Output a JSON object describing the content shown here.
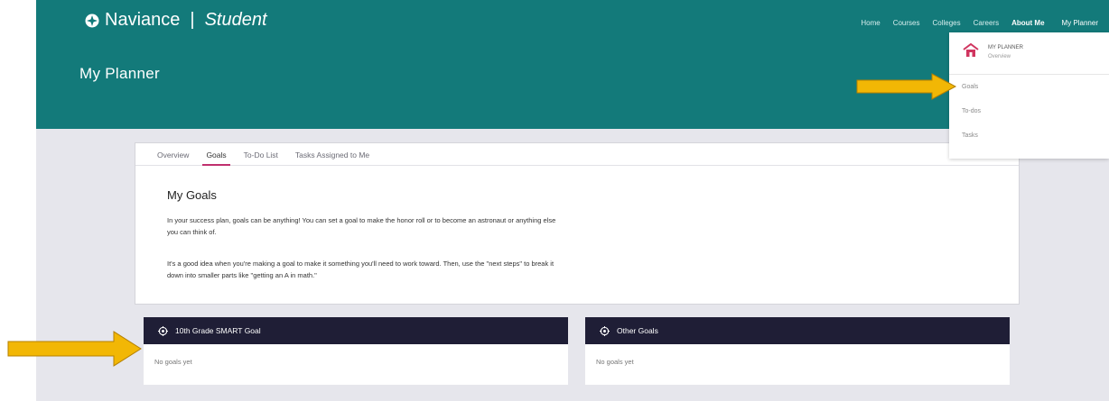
{
  "brand": {
    "name": "Naviance",
    "product": "Student",
    "separator": "|"
  },
  "nav": {
    "items": [
      "Home",
      "Courses",
      "Colleges",
      "Careers",
      "About Me"
    ],
    "active": "My Planner"
  },
  "page_title": "My Planner",
  "tabs": [
    "Overview",
    "Goals",
    "To-Do List",
    "Tasks Assigned to Me"
  ],
  "active_tab": "Goals",
  "goals": {
    "title": "My Goals",
    "paragraph1_line1": "In your success plan, goals can be anything! You can set a goal to make the honor roll or to become an astronaut or anything else",
    "paragraph1_line2": "you can think of.",
    "paragraph2_line1": "It's a good idea when you're making a goal to make it something you'll need to work toward. Then, use the \"next steps\" to break it",
    "paragraph2_line2": "down into smaller parts like \"getting an A in math.\""
  },
  "panels": [
    {
      "title": "10th Grade SMART Goal",
      "empty_text": "No goals yet",
      "icon": "target-icon"
    },
    {
      "title": "Other Goals",
      "empty_text": "No goals yet",
      "icon": "target-icon"
    }
  ],
  "dropdown": {
    "header": "MY PLANNER",
    "subheader": "Overview",
    "items": [
      "Goals",
      "To-dos",
      "Tasks"
    ],
    "icon": "planner-house-icon"
  },
  "colors": {
    "header_teal": "#137a7a",
    "panel_header": "#1f1e36",
    "tab_underline": "#c0306e",
    "arrow": "#f2b705",
    "planner_icon": "#d0355f"
  }
}
